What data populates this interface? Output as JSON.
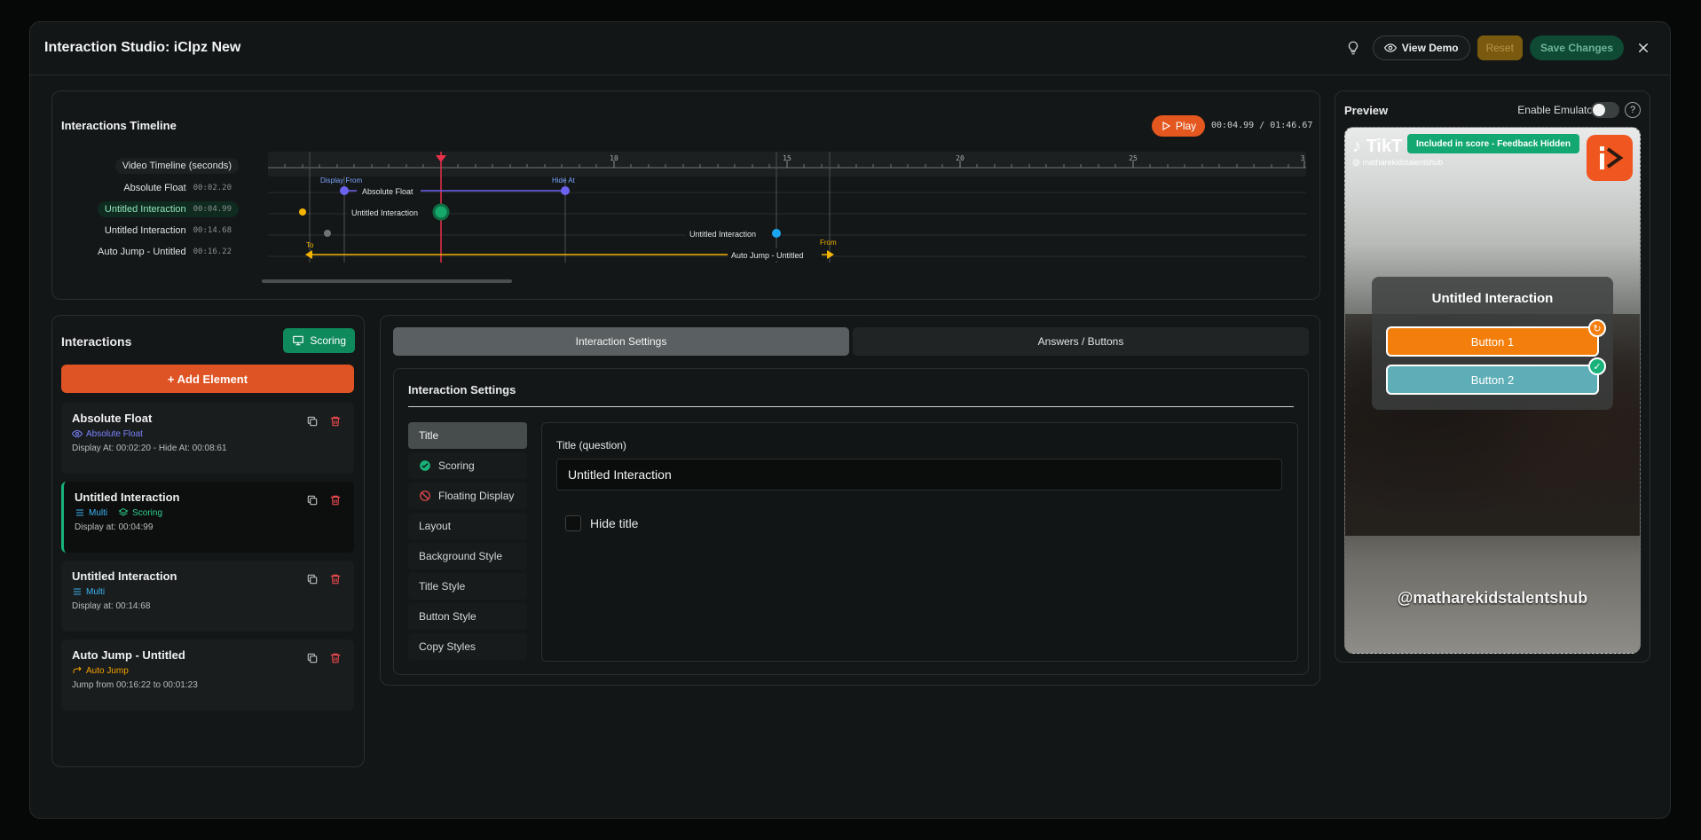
{
  "header": {
    "title": "Interaction Studio: iClpz New",
    "view_demo": "View Demo",
    "reset": "Reset",
    "save": "Save Changes"
  },
  "timeline": {
    "title": "Interactions Timeline",
    "play": "Play",
    "time": "00:04.99 / 01:46.67",
    "ruler_label": "Video Timeline (seconds)",
    "ticks": [
      "5",
      "10",
      "15",
      "20",
      "25",
      "3"
    ],
    "rows": [
      {
        "label": "Absolute Float",
        "time": "00:02.20"
      },
      {
        "label": "Untitled Interaction",
        "time": "00:04.99"
      },
      {
        "label": "Untitled Interaction",
        "time": "00:14.68"
      },
      {
        "label": "Auto Jump - Untitled",
        "time": "00:16.22"
      }
    ],
    "markers": {
      "display_from": "Display From",
      "hide_at": "Hide At",
      "to": "To",
      "from": "From",
      "row1": "Absolute Float",
      "row2": "Untitled Interaction",
      "row3": "Untitled Interaction",
      "row4": "Auto Jump - Untitled"
    }
  },
  "interactions": {
    "title": "Interactions",
    "scoring": "Scoring",
    "add": "+ Add Element",
    "items": [
      {
        "title": "Absolute Float",
        "tag": "Absolute Float",
        "sub": "Display At: 00:02:20 - Hide At: 00:08:61"
      },
      {
        "title": "Untitled Interaction",
        "tag": "Multi",
        "tag2": "Scoring",
        "sub": "Display at: 00:04:99"
      },
      {
        "title": "Untitled Interaction",
        "tag": "Multi",
        "sub": "Display at: 00:14:68"
      },
      {
        "title": "Auto Jump - Untitled",
        "tag": "Auto Jump",
        "sub": "Jump from 00:16:22 to 00:01:23"
      }
    ]
  },
  "settings": {
    "tabs": [
      "Interaction Settings",
      "Answers / Buttons"
    ],
    "section_title": "Interaction Settings",
    "menu": [
      "Title",
      "Scoring",
      "Floating Display",
      "Layout",
      "Background Style",
      "Title Style",
      "Button Style",
      "Copy Styles"
    ],
    "title_label": "Title (question)",
    "title_value": "Untitled Interaction",
    "hide_title": "Hide title"
  },
  "preview": {
    "title": "Preview",
    "emulator": "Enable Emulator",
    "help": "?",
    "tiktok": "TikT",
    "handle": "@ matharekidstalentshub",
    "score_badge": "Included in score - Feedback Hidden",
    "overlay_title": "Untitled Interaction",
    "button1": "Button 1",
    "button2": "Button 2",
    "watermark": "@matharekidstalentshub"
  },
  "colors": {
    "accent_orange": "#df5424",
    "accent_green": "#0f8a5c",
    "timeline_purple": "#6b63f0",
    "timeline_yellow": "#f4b400",
    "timeline_red": "#e8314a",
    "timeline_blue": "#1aa7f0"
  }
}
